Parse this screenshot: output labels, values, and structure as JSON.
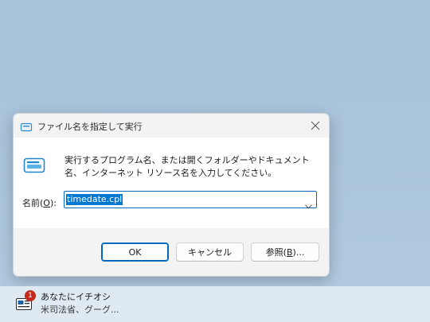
{
  "dialog": {
    "title": "ファイル名を指定して実行",
    "description": "実行するプログラム名、または開くフォルダーやドキュメント名、インターネット リソース名を入力してください。",
    "name_label": {
      "text": "名前(",
      "key": "O",
      "suffix": "):"
    },
    "input_value": "timedate.cpl",
    "buttons": {
      "ok": "OK",
      "cancel": "キャンセル",
      "browse": {
        "text": "参照(",
        "key": "B",
        "suffix": ")..."
      }
    }
  },
  "notification": {
    "badge": "1",
    "title": "あなたにイチオシ",
    "subtitle": "米司法省、グーグ..."
  },
  "icons": {
    "title": "run-icon",
    "close": "close-icon",
    "content": "run-icon",
    "dropdown": "chevron-down-icon",
    "news": "news-icon"
  },
  "colors": {
    "accent": "#0067c0",
    "selection": "#0078d4",
    "badge": "#c42b1c"
  }
}
